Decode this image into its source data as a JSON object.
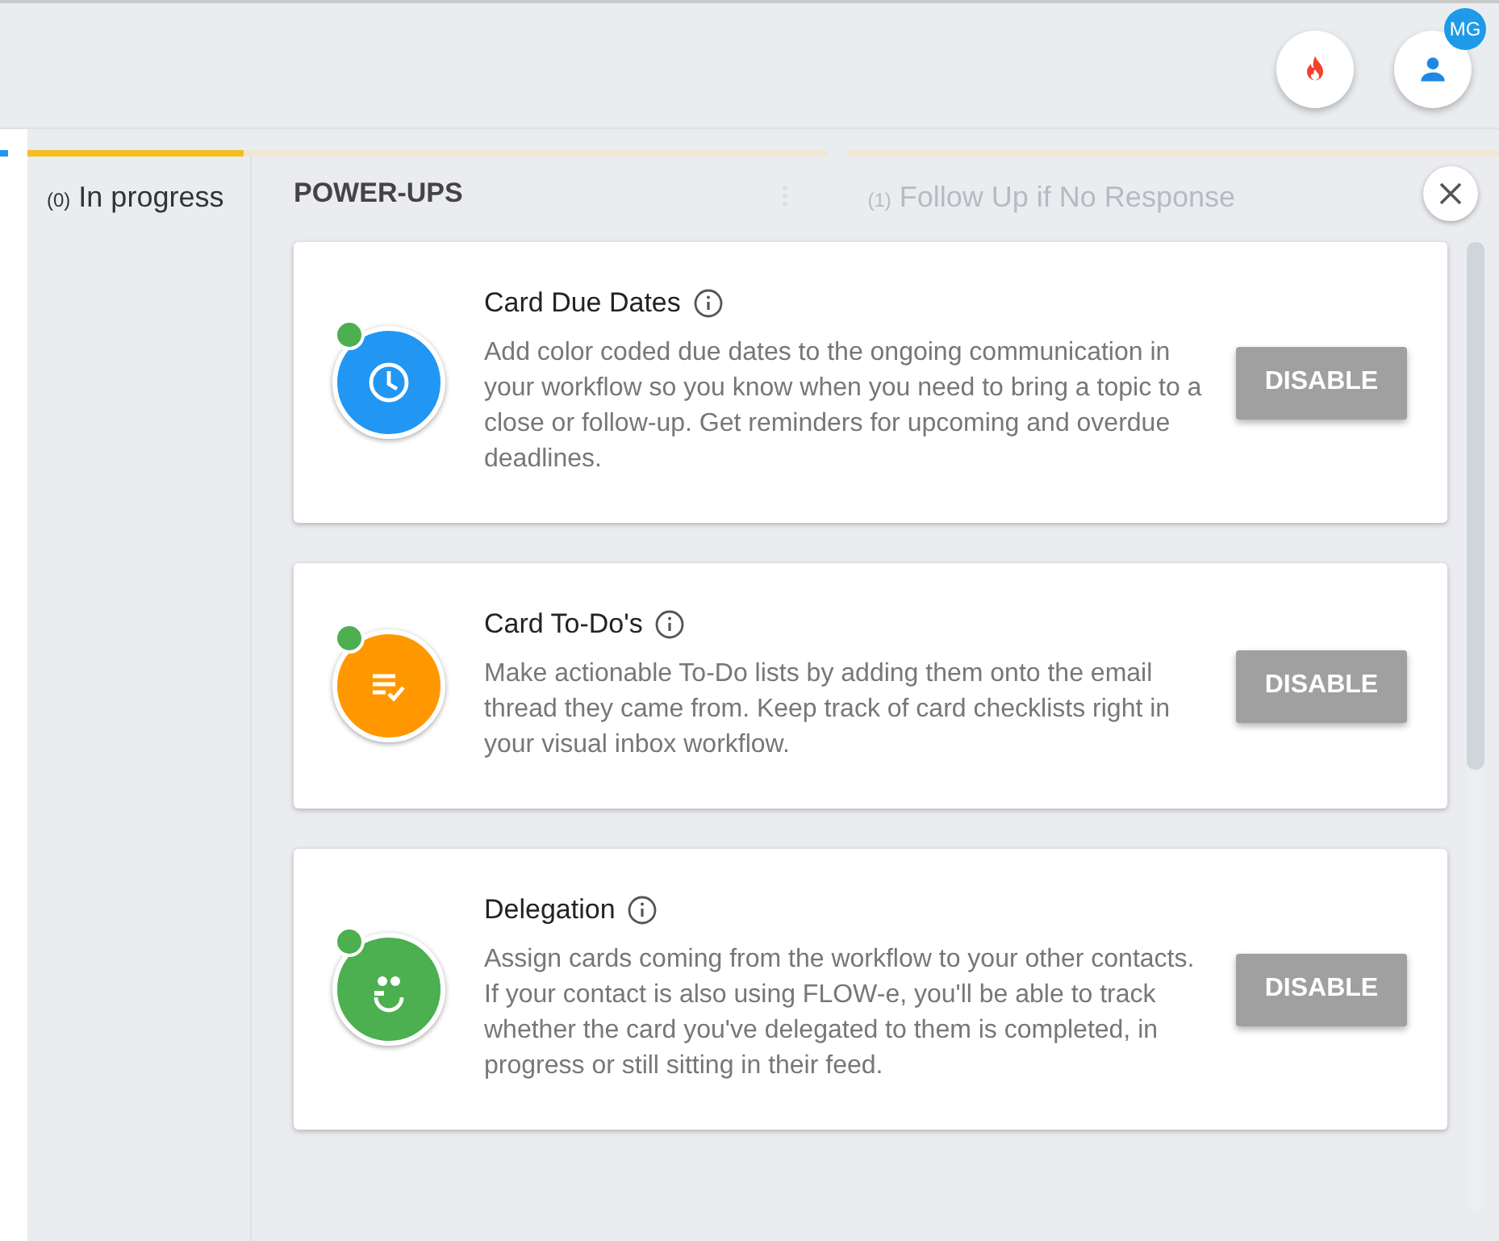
{
  "header": {
    "avatar_badge": "MG"
  },
  "columns": [
    {
      "count": "(0)",
      "title": "In progress",
      "faded": false
    },
    {
      "count": "(1)",
      "title": "Follow Up if No Response",
      "faded": true
    }
  ],
  "panel": {
    "title": "POWER-UPS",
    "items": [
      {
        "title": "Card Due Dates",
        "kind": "clock",
        "color": "#2196f3",
        "enabled": true,
        "description": "Add color coded due dates to the ongoing communication in your workflow so you know when you need to bring a topic to a close or follow-up. Get reminders for upcoming and overdue deadlines.",
        "button": "DISABLE"
      },
      {
        "title": "Card To-Do's",
        "kind": "todo",
        "color": "#ff9800",
        "enabled": true,
        "description": "Make actionable To-Do lists by adding them onto the email thread they came from. Keep track of card checklists right in your visual inbox workflow.",
        "button": "DISABLE"
      },
      {
        "title": "Delegation",
        "kind": "delegate",
        "color": "#4caf50",
        "enabled": true,
        "description": "Assign cards coming from the workflow to your other contacts. If your contact is also using FLOW-e, you'll be able to track whether the card you've delegated to them is completed, in progress or still sitting in their feed.",
        "button": "DISABLE"
      }
    ]
  }
}
